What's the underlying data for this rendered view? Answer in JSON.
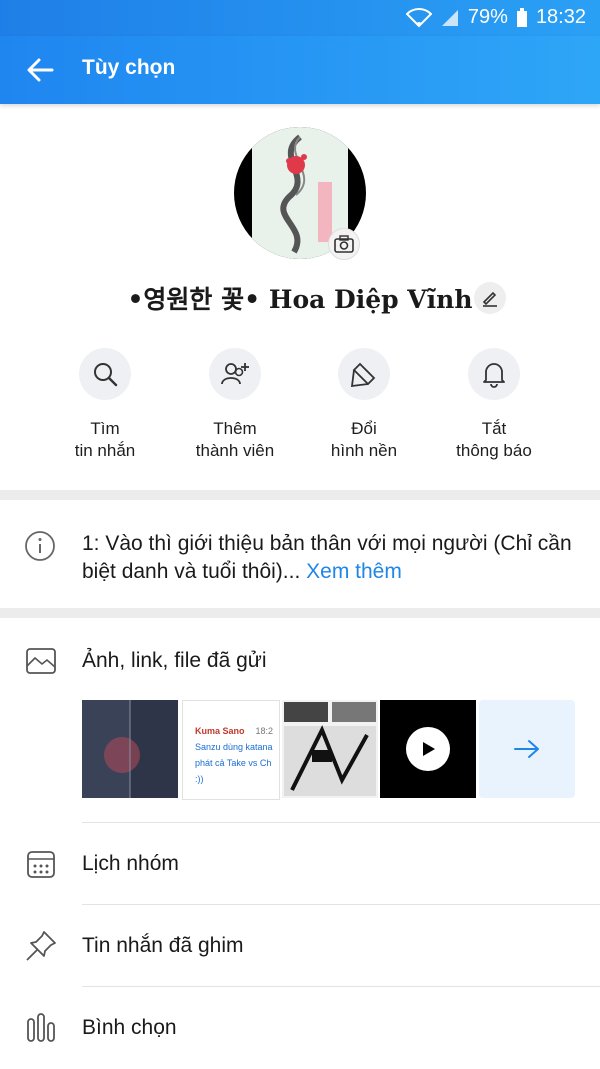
{
  "status_bar": {
    "battery": "79%",
    "time": "18:32"
  },
  "header": {
    "title": "Tùy chọn"
  },
  "group": {
    "name": "•영원한 꽃• Hoa Diệp Vĩnh"
  },
  "actions": [
    {
      "label_line1": "Tìm",
      "label_line2": "tin nhắn",
      "icon": "search-icon"
    },
    {
      "label_line1": "Thêm",
      "label_line2": "thành viên",
      "icon": "add-member-icon"
    },
    {
      "label_line1": "Đổi",
      "label_line2": "hình nền",
      "icon": "paint-brush-icon"
    },
    {
      "label_line1": "Tắt",
      "label_line2": "thông báo",
      "icon": "bell-icon"
    }
  ],
  "description": {
    "text": "1: Vào thì giới thiệu bản thân với mọi người (Chỉ cần biệt danh và tuổi thôi)...",
    "more": " Xem thêm"
  },
  "media": {
    "label": "Ảnh, link, file đã gửi",
    "chat_thumb": {
      "sender": "Kuma Sano",
      "time": "18:2",
      "text": "Sanzu dùng katana phát cả Take vs Ch :))"
    }
  },
  "menu": {
    "calendar": "Lịch nhóm",
    "pinned": "Tin nhắn đã ghim",
    "poll": "Bình chọn"
  },
  "colors": {
    "accent": "#1f86e8",
    "header": "#2196f3"
  }
}
